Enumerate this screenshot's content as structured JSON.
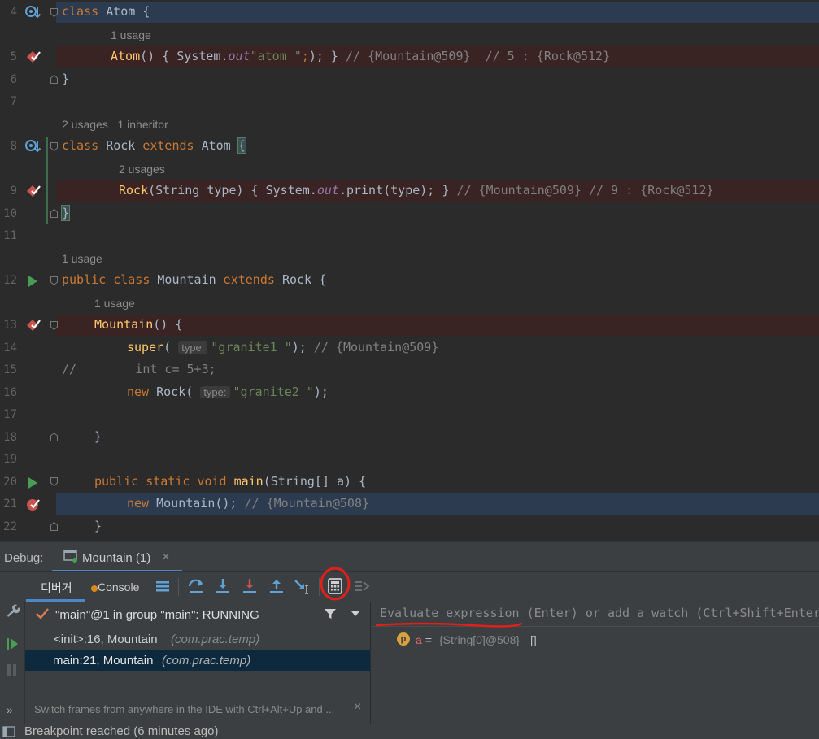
{
  "editor": {
    "lines": [
      {
        "n": "4",
        "code": "class Atom {"
      },
      {
        "n": "",
        "hint": "1 usage"
      },
      {
        "n": "5",
        "code": "Atom() { System.out.print(\"atom \"); } // {Mountain@509}  // 5 : {Rock@512}"
      },
      {
        "n": "6",
        "code": "}"
      },
      {
        "n": "7",
        "code": ""
      },
      {
        "n": "",
        "hint": "2 usages   1 inheritor"
      },
      {
        "n": "8",
        "code": "class Rock extends Atom {"
      },
      {
        "n": "",
        "hint": "2 usages"
      },
      {
        "n": "9",
        "code": "Rock(String type) { System.out.print(type); } // {Mountain@509} // 9 : {Rock@512}"
      },
      {
        "n": "10",
        "code": "}"
      },
      {
        "n": "11",
        "code": ""
      },
      {
        "n": "",
        "hint": "1 usage"
      },
      {
        "n": "12",
        "code": "public class Mountain extends Rock {"
      },
      {
        "n": "",
        "hint": "1 usage"
      },
      {
        "n": "13",
        "code": "Mountain() {"
      },
      {
        "n": "14",
        "code": "super( type: \"granite1 \"); // {Mountain@509}"
      },
      {
        "n": "15",
        "code": "//        int c= 5+3;"
      },
      {
        "n": "16",
        "code": "new Rock( type: \"granite2 \");"
      },
      {
        "n": "17",
        "code": ""
      },
      {
        "n": "18",
        "code": "}"
      },
      {
        "n": "19",
        "code": ""
      },
      {
        "n": "20",
        "code": "public static void main(String[] a) {"
      },
      {
        "n": "21",
        "code": "new Mountain(); // {Mountain@508}"
      },
      {
        "n": "22",
        "code": "}"
      }
    ],
    "t": {
      "class": "class",
      "atom": "Atom",
      "brace_open": " {",
      "brace_close": "}",
      "atom_ctor": "Atom",
      "paren_open": "() { ",
      "system": "System.",
      "out": "out",
      ".print": ".print(",
      "atom_str": "\"atom \"",
      "close1": "); } ",
      "c5": "// {Mountain@509}  // 5 : {Rock@512}",
      "rock": "Rock",
      "extends": " extends ",
      "sp": " ",
      "rock_ctor": "Rock",
      "string_type": "(String type) { ",
      "print_type": ".print(type); } ",
      "c9": "// {Mountain@509} // 9 : {Rock@512}",
      "public_class": "public class ",
      "mountain": "Mountain",
      "mountain_ctor": "Mountain",
      "ctor_tail": "() {",
      "super": "super",
      "paren": "(",
      "hint_type": "type:",
      "granite1": "\"granite1 \"",
      "close_semi": ");",
      "c14": "// {Mountain@509}",
      "c15": "//        int c= 5+3;",
      "new": "new ",
      "rock_call": "Rock(",
      "granite2": "\"granite2 \"",
      "public_static_void": "public static void ",
      "main": "main",
      "main_sig": "(String[] a) {",
      "new_mountain": "Mountain();",
      "c21": "// {Mountain@508}"
    }
  },
  "debug": {
    "label": "Debug:",
    "tab_title": "Mountain (1)",
    "tab_close": "×",
    "tabs": [
      "디버거",
      "Console"
    ],
    "thread": "\"main\"@1 in group \"main\": RUNNING",
    "frames": [
      {
        "method": "<init>:16, Mountain",
        "pkg": "(com.prac.temp)"
      },
      {
        "method": "main:21, Mountain",
        "pkg": "(com.prac.temp)"
      }
    ],
    "frames_hint": "Switch frames from anywhere in the IDE with Ctrl+Alt+Up and ...",
    "eval_placeholder": "Evaluate expression (Enter) or add a watch (Ctrl+Shift+Enter)",
    "variable": {
      "badge": "p",
      "name": "a",
      "eq": " = ",
      "value": "{String[0]@508}",
      "extra": "[]"
    },
    "status": "Breakpoint reached (6 minutes ago)"
  },
  "colors": {
    "accent": "#4a88c7",
    "breakpoint": "#c75450",
    "annotation": "#e0201a"
  }
}
